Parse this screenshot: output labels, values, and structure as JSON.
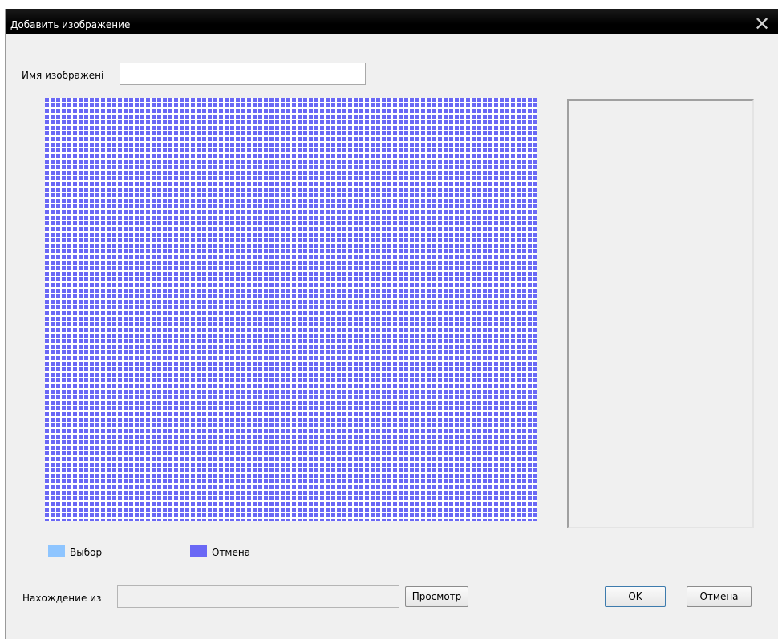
{
  "window": {
    "title": "Добавить изображение",
    "close_symbol": "✕"
  },
  "form": {
    "name_label": "Имя изображені",
    "name_value": "",
    "source_label": "Нахождение из",
    "source_value": "",
    "browse_label": "Просмотр"
  },
  "legend": {
    "select_label": "Выбор",
    "select_color": "#8ec5ff",
    "cancel_label": "Отмена",
    "cancel_color": "#6a68f5"
  },
  "buttons": {
    "ok_label": "OK",
    "cancel_label": "Отмена"
  },
  "icons": {
    "close": "close-icon"
  }
}
